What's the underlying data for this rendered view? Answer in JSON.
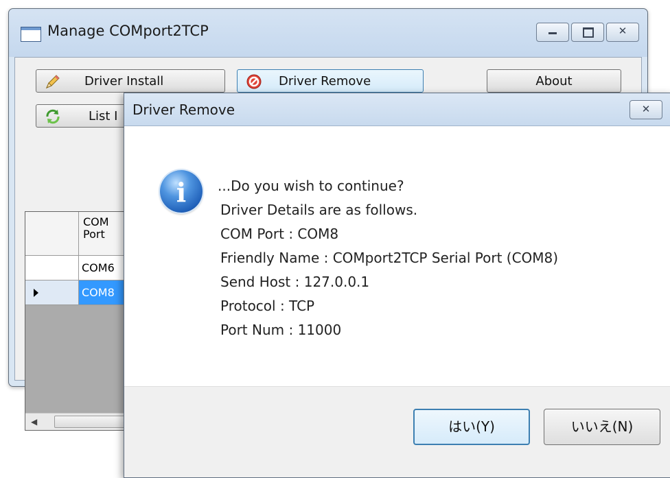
{
  "main_window": {
    "title": "Manage COMport2TCP",
    "buttons": {
      "driver_install": "Driver Install",
      "driver_remove": "Driver Remove",
      "about": "About",
      "list": "List I"
    },
    "grid": {
      "column_header_line1": "COM",
      "column_header_line2": "Port",
      "rows": [
        {
          "com_port": "COM6",
          "selected": false
        },
        {
          "com_port": "COM8",
          "selected": true
        }
      ]
    }
  },
  "dialog": {
    "title": "Driver Remove",
    "close_glyph": "✕",
    "message_lines": [
      "...Do you wish to continue?",
      "Driver Details are as follows.",
      "COM Port : COM8",
      "Friendly Name : COMport2TCP Serial Port (COM8)",
      "Send Host : 127.0.0.1",
      "Protocol : TCP",
      "Port Num : 11000"
    ],
    "yes_label": "はい(Y)",
    "no_label": "いいえ(N)",
    "icon": "information-icon"
  },
  "colors": {
    "selection": "#3399ff",
    "titlebar": "#c8daee",
    "focus_border": "#3c7fb1"
  }
}
